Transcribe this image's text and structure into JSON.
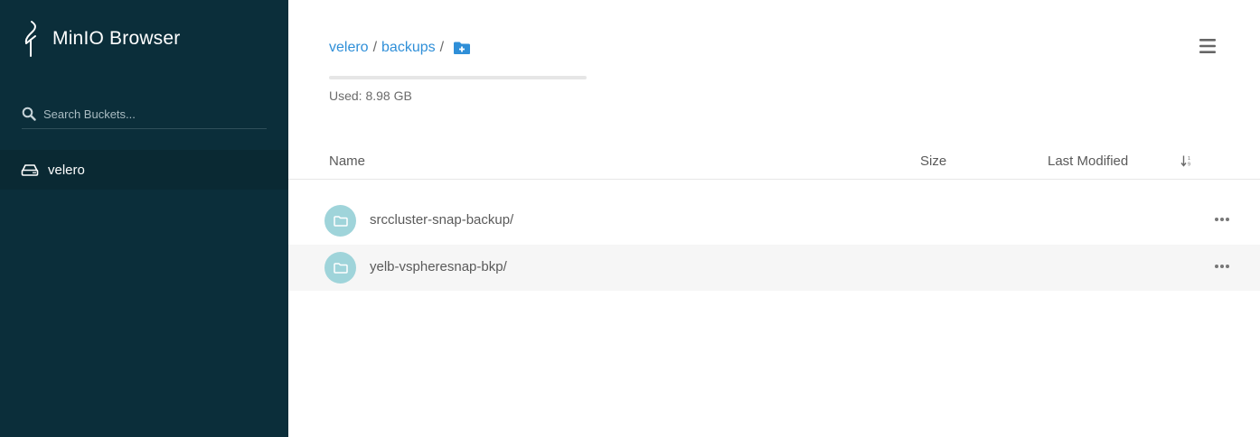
{
  "sidebar": {
    "brand": "MinIO Browser",
    "search_placeholder": "Search Buckets...",
    "buckets": [
      {
        "label": "velero",
        "active": true
      }
    ]
  },
  "main": {
    "breadcrumb": [
      "velero",
      "backups"
    ],
    "breadcrumb_separator": "/",
    "storage": {
      "used_label": "Used: 8.98 GB",
      "used_fraction": 0.0
    },
    "table": {
      "columns": {
        "name": "Name",
        "size": "Size",
        "last_modified": "Last Modified"
      },
      "rows": [
        {
          "name": "srccluster-snap-backup/",
          "type": "folder"
        },
        {
          "name": "yelb-vspheresnap-bkp/",
          "type": "folder"
        }
      ]
    }
  },
  "colors": {
    "sidebar_bg": "#0b2e3a",
    "link": "#2f8fd8",
    "folder_badge": "#9fd4da",
    "row_alt": "#f6f6f6"
  },
  "icons": [
    "minio-logo-icon",
    "search-icon",
    "bucket-drive-icon",
    "add-folder-icon",
    "hamburger-menu-icon",
    "sort-icon",
    "folder-icon",
    "more-options-icon"
  ]
}
